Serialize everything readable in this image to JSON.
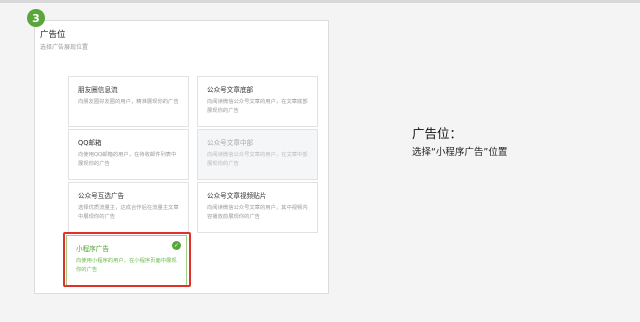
{
  "step": {
    "number": "3"
  },
  "panel": {
    "title": "广告位",
    "subtitle": "选择广告展现位置"
  },
  "cards": [
    {
      "title": "朋友圈信息流",
      "desc": "向朋友圈好友圈的用户，精准展现你的广告"
    },
    {
      "title": "公众号文章底部",
      "desc": "向阅读微信公众号文章的用户，在文章底部展现你的广告"
    },
    {
      "title": "QQ邮箱",
      "desc": "向使用QQ邮箱的用户，在待收邮件列表中展现你的广告"
    },
    {
      "title": "公众号文章中部",
      "desc": "向阅读微信公众号文章的用户，在文章中部展现你的广告",
      "state": "disabled"
    },
    {
      "title": "公众号互选广告",
      "desc": "选择优质流量主，达成合作后在流量主文章中展现你的广告"
    },
    {
      "title": "公众号文章视频贴片",
      "desc": "向阅读微信公众号文章的用户，其中视频内容播放前展现你的广告"
    },
    {
      "title": "小程序广告",
      "desc": "向使用小程序的用户，在小程序页面中展现你的广告",
      "state": "selected"
    }
  ],
  "annotation": {
    "title": "广告位：",
    "desc": "选择“小程序广告”位置"
  },
  "colors": {
    "accent": "#5aa63c",
    "highlight": "#e0312b"
  }
}
